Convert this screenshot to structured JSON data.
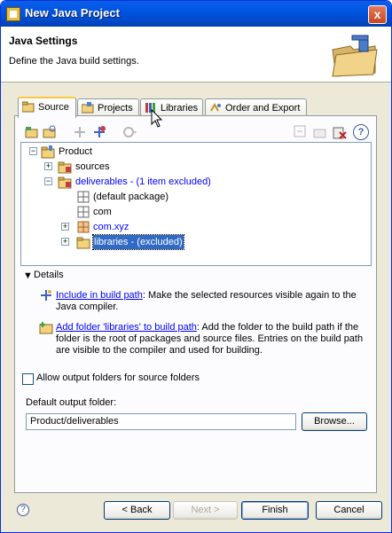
{
  "window": {
    "title": "New Java Project",
    "close_label": "x"
  },
  "header": {
    "title": "Java Settings",
    "description": "Define the Java build settings."
  },
  "tabs": [
    {
      "label": "Source",
      "icon": "source-folder-icon"
    },
    {
      "label": "Projects",
      "icon": "projects-icon"
    },
    {
      "label": "Libraries",
      "icon": "libraries-icon"
    },
    {
      "label": "Order and Export",
      "icon": "order-export-icon"
    }
  ],
  "toolbar": {
    "left_icons": [
      "add-source-folder-icon",
      "link-source-icon",
      "include-icon",
      "exclude-icon",
      "configure-build-path-icon"
    ],
    "right_icons": [
      "collapse-icon",
      "new-folder-icon",
      "remove-icon",
      "help-icon"
    ],
    "help_label": "?"
  },
  "tree": {
    "root": "Product",
    "nodes": [
      {
        "label": "sources"
      },
      {
        "label": "deliverables - (1 item excluded)"
      },
      {
        "label": "(default package)"
      },
      {
        "label": "com"
      },
      {
        "label": "com.xyz"
      },
      {
        "label": "libraries - (excluded)"
      }
    ]
  },
  "details": {
    "label": "Details",
    "include_link": "Include in build path",
    "include_text": ": Make the selected resources visible again to the Java compiler.",
    "add_link": "Add folder 'libraries' to build path",
    "add_text": ": Add the folder to the build path if the folder is the root of packages and source files. Entries on the build path are visible to the compiler and used for building."
  },
  "options": {
    "allow_output_label": "Allow output folders for source folders",
    "allow_output_checked": false,
    "default_output_label": "Default output folder:",
    "default_output_value": "Product/deliverables",
    "browse_label": "Browse..."
  },
  "footer": {
    "help": "?",
    "back": "< Back",
    "next": "Next >",
    "finish": "Finish",
    "cancel": "Cancel"
  }
}
